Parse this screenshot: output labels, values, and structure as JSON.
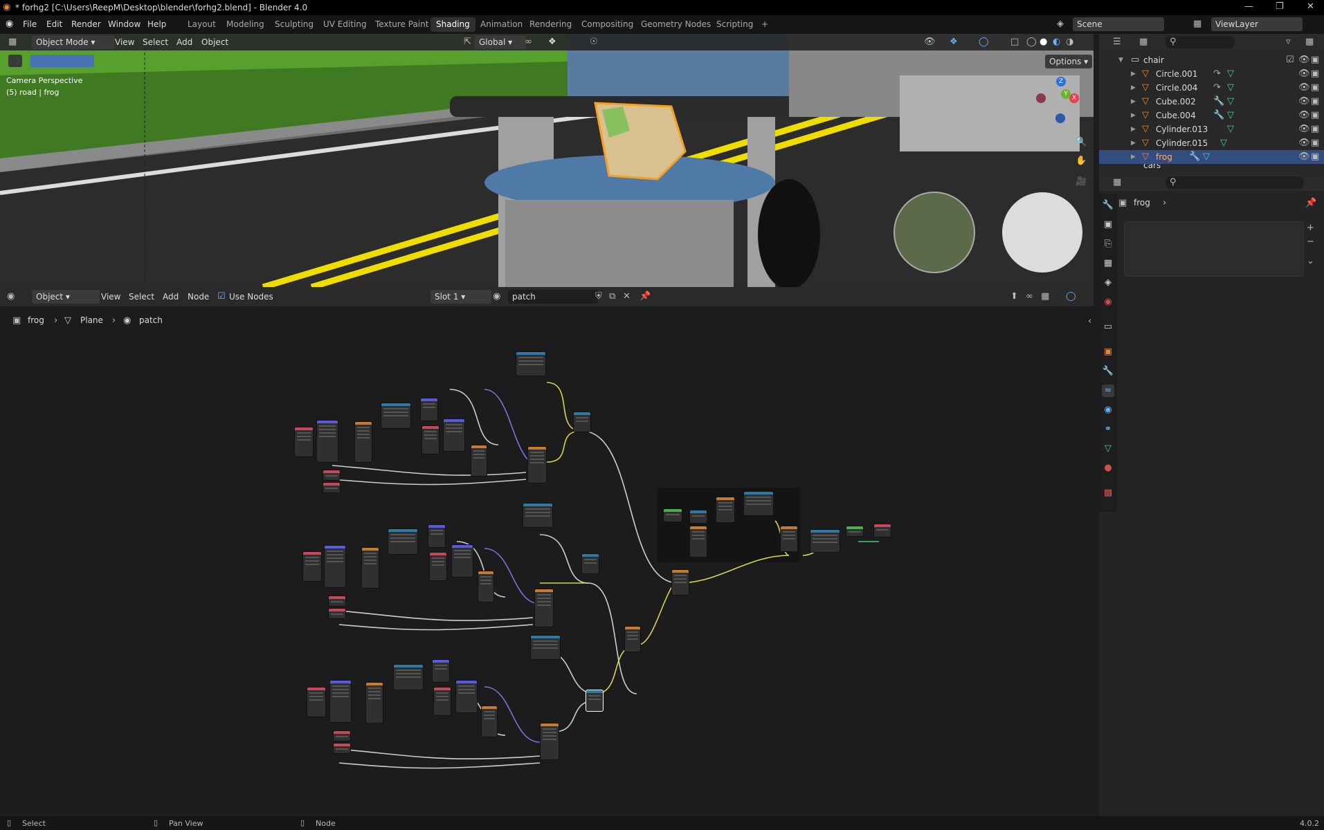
{
  "window": {
    "title": "* forhg2 [C:\\Users\\ReepM\\Desktop\\blender\\forhg2.blend] - Blender 4.0",
    "minimize": "—",
    "restore": "❐",
    "close": "✕"
  },
  "menu": {
    "items": [
      "File",
      "Edit",
      "Render",
      "Window",
      "Help"
    ],
    "workspaces": [
      "Layout",
      "Modeling",
      "Sculpting",
      "UV Editing",
      "Texture Paint",
      "Shading",
      "Animation",
      "Rendering",
      "Compositing",
      "Geometry Nodes",
      "Scripting"
    ],
    "active_workspace": "Shading",
    "add_workspace": "+",
    "scene": "Scene",
    "view_layer": "ViewLayer"
  },
  "viewport": {
    "mode": "Object Mode",
    "menus": [
      "View",
      "Select",
      "Add",
      "Object"
    ],
    "orientation": "Global",
    "options": "Options",
    "overlay_line1": "Camera Perspective",
    "overlay_line2": "(5) road | frog",
    "gizmo_x": "X",
    "gizmo_y": "Y",
    "gizmo_z": "Z"
  },
  "outliner": {
    "collection": "chair",
    "items": [
      {
        "name": "Circle.001"
      },
      {
        "name": "Circle.004"
      },
      {
        "name": "Cube.002"
      },
      {
        "name": "Cube.004"
      },
      {
        "name": "Cylinder.013"
      },
      {
        "name": "Cylinder.015"
      },
      {
        "name": "frog",
        "selected": true
      }
    ],
    "next_collection": "cars"
  },
  "properties": {
    "object_name": "frog"
  },
  "node_editor": {
    "mode": "Object",
    "menus": [
      "View",
      "Select",
      "Add",
      "Node"
    ],
    "use_nodes_label": "Use Nodes",
    "slot": "Slot 1",
    "material": "patch",
    "breadcrumb": [
      "frog",
      "Plane",
      "patch"
    ]
  },
  "statusbar": {
    "select": "Select",
    "pan": "Pan View",
    "node": "Node",
    "version": "4.0.2"
  },
  "colors": {
    "accent": "#4772b3",
    "selection": "#334d80",
    "header": "#2a2a2a",
    "background": "#1c1c1c"
  }
}
